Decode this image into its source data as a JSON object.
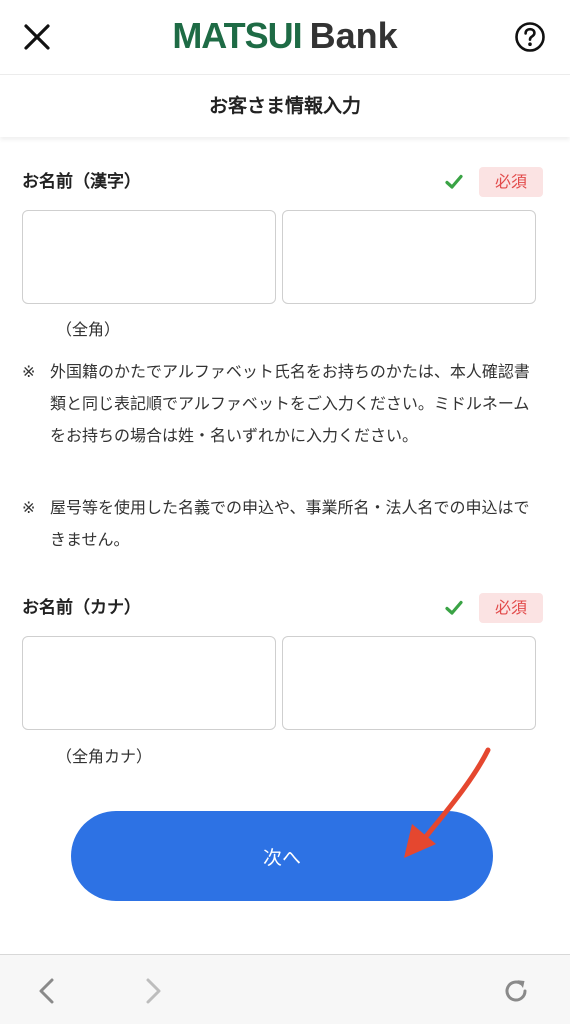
{
  "header": {
    "logo_primary": "MATSUI",
    "logo_secondary": "Bank",
    "logo_color": "#1e6b45",
    "close_icon": "close-icon",
    "help_icon": "help-icon"
  },
  "page_title": "お客さま情報入力",
  "name_kanji": {
    "label": "お名前（漢字）",
    "required": "必須",
    "hint": "（全角）",
    "last_name_value": "",
    "first_name_value": ""
  },
  "notes": [
    {
      "mark": "※",
      "text": "外国籍のかたでアルファベット氏名をお持ちのかたは、本人確認書類と同じ表記順でアルファベットをご入力ください。ミドルネームをお持ちの場合は姓・名いずれかに入力ください。"
    },
    {
      "mark": "※",
      "text": "屋号等を使用した名義での申込や、事業所名・法人名での申込はできません。"
    }
  ],
  "name_kana": {
    "label": "お名前（カナ）",
    "required": "必須",
    "hint": "（全角カナ）",
    "last_name_value": "",
    "first_name_value": ""
  },
  "next_button": {
    "label": "次へ",
    "color": "#2d72e4"
  },
  "annotation_color": "#e5472f",
  "colors": {
    "check": "#3aa345",
    "required_bg": "#fbe3e3",
    "required_text": "#e24a4a"
  }
}
